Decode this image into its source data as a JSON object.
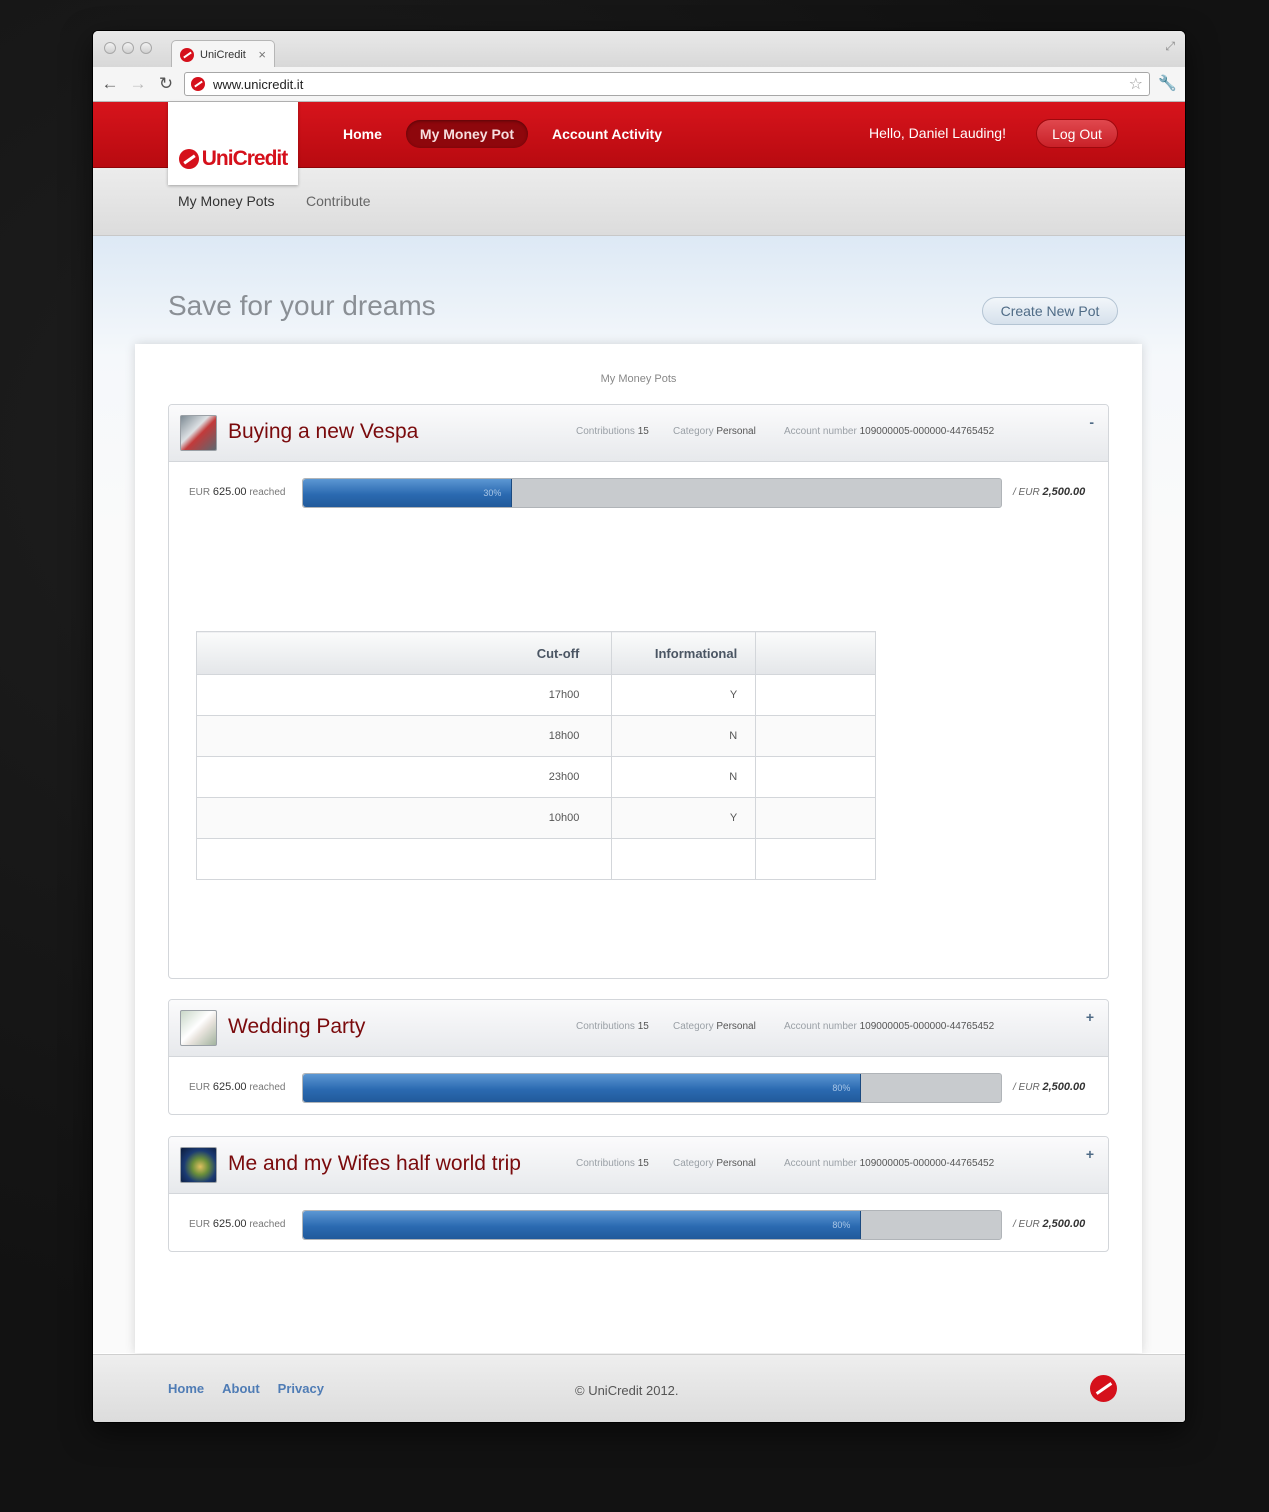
{
  "browser": {
    "tab_title": "UniCredit",
    "tab_close": "×",
    "url": "www.unicredit.it"
  },
  "header": {
    "logo_text": "UniCredit",
    "nav": [
      {
        "label": "Home"
      },
      {
        "label": "My Money Pot",
        "active": true
      },
      {
        "label": "Account Activity"
      }
    ],
    "greeting": "Hello,  Daniel Lauding!",
    "logout_label": "Log Out"
  },
  "subnav": {
    "items": [
      {
        "label": "My Money Pots",
        "current": true
      },
      {
        "label": "Contribute"
      }
    ]
  },
  "main": {
    "title": "Save for your dreams",
    "create_label": "Create New Pot",
    "panel_title": "My Money Pots",
    "meta_labels": {
      "contributions": "Contributions",
      "category": "Category",
      "account": "Account number"
    },
    "reached_suffix": "reached",
    "pots": [
      {
        "name": "Buying a new Vespa",
        "thumbnail": "vespa-photo",
        "toggle": "-",
        "contributions": "15",
        "category": "Personal",
        "account": "109000005-000000-44765452",
        "reached_currency": "EUR",
        "reached_amount": "625.00",
        "progress_percent": 30,
        "progress_label": "30%",
        "target_prefix": "/ EUR",
        "target_amount": "2,500.00"
      },
      {
        "name": "Wedding Party",
        "thumbnail": "wedding-photo",
        "toggle": "+",
        "contributions": "15",
        "category": "Personal",
        "account": "109000005-000000-44765452",
        "reached_currency": "EUR",
        "reached_amount": "625.00",
        "progress_percent": 80,
        "progress_label": "80%",
        "target_prefix": "/ EUR",
        "target_amount": "2,500.00"
      },
      {
        "name": "Me and my Wifes half world trip",
        "thumbnail": "world-photo",
        "toggle": "+",
        "contributions": "15",
        "category": "Personal",
        "account": "109000005-000000-44765452",
        "reached_currency": "EUR",
        "reached_amount": "625.00",
        "progress_percent": 80,
        "progress_label": "80%",
        "target_prefix": "/ EUR",
        "target_amount": "2,500.00"
      }
    ],
    "table": {
      "headers": [
        "Cut-off",
        "Informational"
      ],
      "rows": [
        {
          "cutoff": "17h00",
          "informational": "Y"
        },
        {
          "cutoff": "18h00",
          "informational": "N"
        },
        {
          "cutoff": "23h00",
          "informational": "N"
        },
        {
          "cutoff": "10h00",
          "informational": "Y"
        }
      ]
    }
  },
  "footer": {
    "links": [
      "Home",
      "About",
      "Privacy"
    ],
    "copyright": "© UniCredit 2012."
  },
  "colors": {
    "brand_red": "#d5101b",
    "bar_blue": "#2b6ab1",
    "link_blue": "#4f7cb5"
  }
}
